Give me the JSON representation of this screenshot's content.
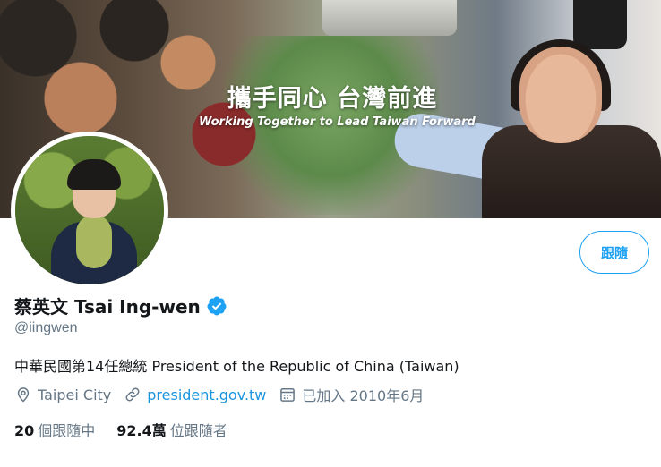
{
  "banner": {
    "title": "攜手同心 台灣前進",
    "subtitle": "Working Together to Lead Taiwan Forward"
  },
  "profile": {
    "display_name": "蔡英文 Tsai Ing-wen",
    "handle": "@iingwen",
    "verified": true,
    "bio": "中華民國第14任總統 President of the Republic of China (Taiwan)",
    "location": "Taipei City",
    "website": "president.gov.tw",
    "joined": "已加入 2010年6月"
  },
  "actions": {
    "follow_label": "跟隨"
  },
  "stats": {
    "following_count": "20",
    "following_label": "個跟隨中",
    "followers_count": "92.4萬",
    "followers_label": "位跟隨者"
  },
  "icons": {
    "verified": "verified-badge-icon",
    "location": "location-pin-icon",
    "link": "link-icon",
    "calendar": "calendar-icon"
  },
  "colors": {
    "accent": "#1da1f2",
    "link": "#1b95e0",
    "secondary_text": "#657786",
    "primary_text": "#14171a"
  }
}
